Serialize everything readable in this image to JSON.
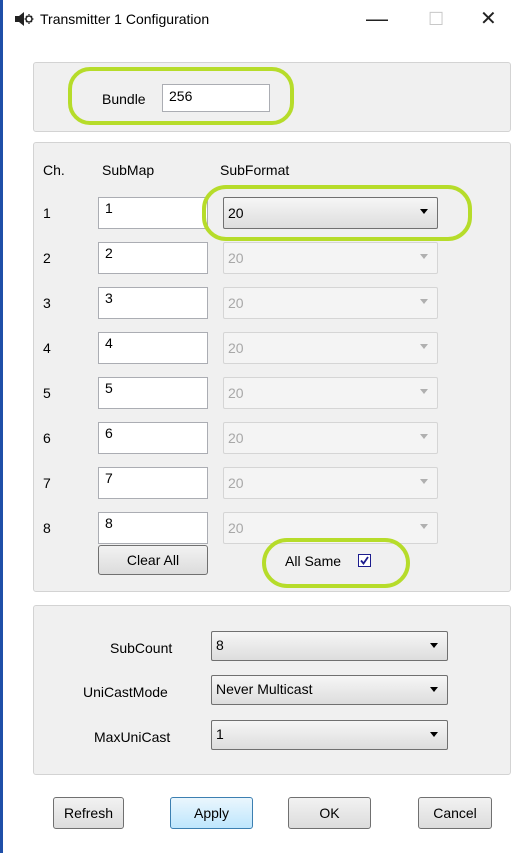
{
  "window": {
    "title": "Transmitter 1 Configuration",
    "controls": {
      "minimize": "—",
      "maximize": "☐",
      "close": "✕"
    }
  },
  "bundle": {
    "label": "Bundle",
    "value": "256"
  },
  "grid": {
    "headers": {
      "ch": "Ch.",
      "submap": "SubMap",
      "subformat": "SubFormat"
    },
    "rows": [
      {
        "ch": "1",
        "submap": "1",
        "subformat": "20",
        "enabled": true
      },
      {
        "ch": "2",
        "submap": "2",
        "subformat": "20",
        "enabled": false
      },
      {
        "ch": "3",
        "submap": "3",
        "subformat": "20",
        "enabled": false
      },
      {
        "ch": "4",
        "submap": "4",
        "subformat": "20",
        "enabled": false
      },
      {
        "ch": "5",
        "submap": "5",
        "subformat": "20",
        "enabled": false
      },
      {
        "ch": "6",
        "submap": "6",
        "subformat": "20",
        "enabled": false
      },
      {
        "ch": "7",
        "submap": "7",
        "subformat": "20",
        "enabled": false
      },
      {
        "ch": "8",
        "submap": "8",
        "subformat": "20",
        "enabled": false
      }
    ],
    "clear_all_label": "Clear All",
    "all_same_label": "All Same",
    "all_same_checked": true
  },
  "settings": {
    "subcount": {
      "label": "SubCount",
      "value": "8"
    },
    "unicast_mode": {
      "label": "UniCastMode",
      "value": "Never Multicast"
    },
    "max_unicast": {
      "label": "MaxUniCast",
      "value": "1"
    }
  },
  "buttons": {
    "refresh": "Refresh",
    "apply": "Apply",
    "ok": "OK",
    "cancel": "Cancel"
  },
  "colors": {
    "highlight": "#b6dc2a",
    "window_edge": "#1f4fa8",
    "panel": "#f0f0f0"
  }
}
